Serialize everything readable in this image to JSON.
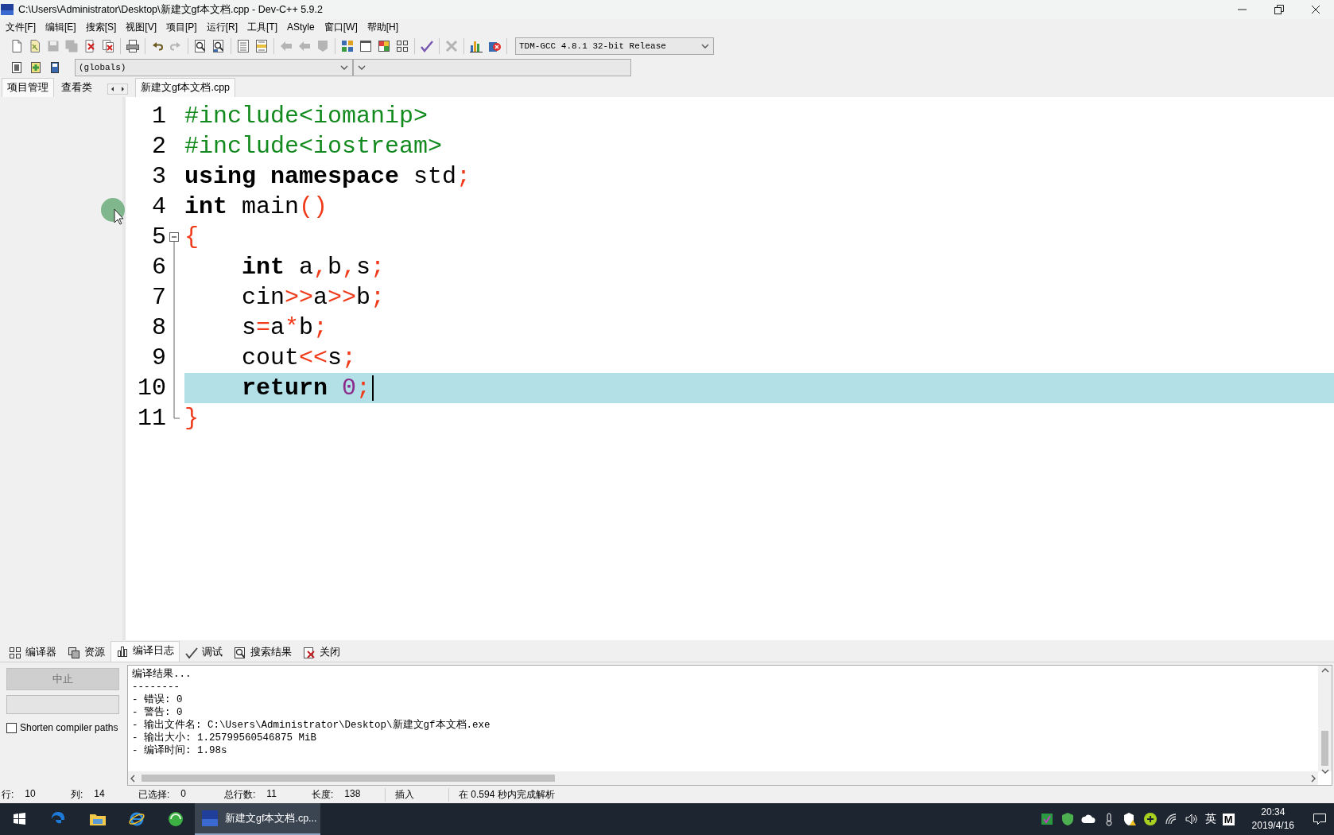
{
  "window": {
    "title": "C:\\Users\\Administrator\\Desktop\\新建文gf本文档.cpp - Dev-C++ 5.9.2"
  },
  "menu": [
    "文件[F]",
    "编辑[E]",
    "搜索[S]",
    "视图[V]",
    "项目[P]",
    "运行[R]",
    "工具[T]",
    "AStyle",
    "窗口[W]",
    "帮助[H]"
  ],
  "toolbar": [
    {
      "buttons": [
        {
          "kind": "new",
          "disabled": false
        },
        {
          "kind": "open",
          "disabled": false
        },
        {
          "kind": "save",
          "disabled": true
        },
        {
          "kind": "saveall",
          "disabled": true
        },
        {
          "kind": "close",
          "disabled": false
        },
        {
          "kind": "closeall",
          "disabled": false
        }
      ]
    },
    {
      "buttons": [
        {
          "kind": "print",
          "disabled": false
        }
      ]
    },
    {
      "buttons": [
        {
          "kind": "undo",
          "disabled": false
        },
        {
          "kind": "redo",
          "disabled": true
        }
      ]
    },
    {
      "buttons": [
        {
          "kind": "find",
          "disabled": false
        },
        {
          "kind": "replace",
          "disabled": false
        }
      ]
    },
    {
      "buttons": [
        {
          "kind": "indent",
          "disabled": false
        },
        {
          "kind": "unindent",
          "disabled": false
        }
      ]
    },
    {
      "buttons": [
        {
          "kind": "prev",
          "disabled": true
        },
        {
          "kind": "next",
          "disabled": true
        },
        {
          "kind": "bookmark",
          "disabled": true
        }
      ]
    },
    {
      "buttons": [
        {
          "kind": "grid",
          "disabled": false
        },
        {
          "kind": "window",
          "disabled": false
        },
        {
          "kind": "colors",
          "disabled": false
        },
        {
          "kind": "tiles",
          "disabled": false
        }
      ]
    },
    {
      "buttons": [
        {
          "kind": "check",
          "disabled": false
        }
      ]
    },
    {
      "buttons": [
        {
          "kind": "cross",
          "disabled": true
        }
      ]
    },
    {
      "buttons": [
        {
          "kind": "chart",
          "disabled": false
        },
        {
          "kind": "stop",
          "disabled": false
        }
      ]
    }
  ],
  "compiler": {
    "value": "TDM-GCC 4.8.1 32-bit Release"
  },
  "scope": {
    "value": "(globals)"
  },
  "side_tabs": [
    {
      "label": "项目管理",
      "selected": true
    },
    {
      "label": "查看类",
      "selected": false
    }
  ],
  "editor_tabs": [
    {
      "label": "新建文gf本文档.cpp",
      "selected": true
    }
  ],
  "code": [
    {
      "number": "1",
      "current": false,
      "indented": false,
      "kind": "plain",
      "tokens": [
        {
          "kind": "preprocessor",
          "text": "#include<iomanip>"
        }
      ]
    },
    {
      "number": "2",
      "current": false,
      "indented": false,
      "kind": "plain",
      "tokens": [
        {
          "kind": "preprocessor",
          "text": "#include<iostream>"
        }
      ]
    },
    {
      "number": "3",
      "current": false,
      "indented": false,
      "kind": "plain",
      "tokens": [
        {
          "kind": "keyword",
          "text": "using namespace"
        },
        {
          "kind": "plain",
          "text": " std"
        },
        {
          "kind": "symbol",
          "text": ";"
        }
      ]
    },
    {
      "number": "4",
      "current": false,
      "indented": false,
      "kind": "plain",
      "tokens": [
        {
          "kind": "keyword",
          "text": "int"
        },
        {
          "kind": "plain",
          "text": " main"
        },
        {
          "kind": "symbol",
          "text": "()"
        }
      ]
    },
    {
      "number": "5",
      "current": false,
      "indented": false,
      "kind": "foldstart",
      "tokens": [
        {
          "kind": "symbol",
          "text": "{"
        }
      ]
    },
    {
      "number": "6",
      "current": false,
      "indented": true,
      "kind": "folded",
      "tokens": [
        {
          "kind": "keyword",
          "text": "int"
        },
        {
          "kind": "plain",
          "text": " a"
        },
        {
          "kind": "symbol",
          "text": ","
        },
        {
          "kind": "plain",
          "text": "b"
        },
        {
          "kind": "symbol",
          "text": ","
        },
        {
          "kind": "plain",
          "text": "s"
        },
        {
          "kind": "symbol",
          "text": ";"
        }
      ]
    },
    {
      "number": "7",
      "current": false,
      "indented": true,
      "kind": "folded",
      "tokens": [
        {
          "kind": "plain",
          "text": "cin"
        },
        {
          "kind": "symbol",
          "text": ">>"
        },
        {
          "kind": "plain",
          "text": "a"
        },
        {
          "kind": "symbol",
          "text": ">>"
        },
        {
          "kind": "plain",
          "text": "b"
        },
        {
          "kind": "symbol",
          "text": ";"
        }
      ]
    },
    {
      "number": "8",
      "current": false,
      "indented": true,
      "kind": "folded",
      "tokens": [
        {
          "kind": "plain",
          "text": "s"
        },
        {
          "kind": "symbol",
          "text": "="
        },
        {
          "kind": "plain",
          "text": "a"
        },
        {
          "kind": "symbol",
          "text": "*"
        },
        {
          "kind": "plain",
          "text": "b"
        },
        {
          "kind": "symbol",
          "text": ";"
        }
      ]
    },
    {
      "number": "9",
      "current": false,
      "indented": true,
      "kind": "folded",
      "tokens": [
        {
          "kind": "plain",
          "text": "cout"
        },
        {
          "kind": "symbol",
          "text": "<<"
        },
        {
          "kind": "plain",
          "text": "s"
        },
        {
          "kind": "symbol",
          "text": ";"
        }
      ]
    },
    {
      "number": "10",
      "current": true,
      "indented": true,
      "kind": "folded",
      "tokens": [
        {
          "kind": "keyword",
          "text": "return"
        },
        {
          "kind": "number",
          "text": " 0"
        },
        {
          "kind": "symbol",
          "text": ";"
        }
      ]
    },
    {
      "number": "11",
      "current": false,
      "indented": false,
      "kind": "foldend",
      "tokens": [
        {
          "kind": "symbol",
          "text": "}"
        }
      ]
    }
  ],
  "bottom_tabs": [
    {
      "kind": "compiler",
      "label": "编译器",
      "selected": false
    },
    {
      "kind": "resources",
      "label": "资源",
      "selected": false
    },
    {
      "kind": "log",
      "label": "编译日志",
      "selected": true
    },
    {
      "kind": "debug",
      "label": "调试",
      "selected": false
    },
    {
      "kind": "search",
      "label": "搜索结果",
      "selected": false
    },
    {
      "kind": "close",
      "label": "关闭",
      "selected": false
    }
  ],
  "abort_button": {
    "label": "中止",
    "disabled": true
  },
  "progress": {
    "level": 0
  },
  "shorten_paths": {
    "label": "Shorten compiler paths",
    "checked": false
  },
  "log": [
    "编译结果...",
    "--------",
    "- 错误: 0",
    "- 警告: 0",
    "- 输出文件名: C:\\Users\\Administrator\\Desktop\\新建文gf本文档.exe",
    "- 输出大小: 1.25799560546875 MiB",
    "- 编译时间: 1.98s"
  ],
  "status": {
    "fields": [
      {
        "label": "行:",
        "value": "10"
      },
      {
        "label": "列:",
        "value": "14"
      },
      {
        "label": "已选择:",
        "value": "0"
      },
      {
        "label": "总行数:",
        "value": "11"
      },
      {
        "label": "长度:",
        "value": "138"
      }
    ],
    "messages": [
      "插入",
      "在 0.594 秒内完成解析"
    ]
  },
  "taskbar": {
    "tasks": [
      {
        "label": "新建文gf本文档.cp...",
        "active": true
      }
    ],
    "ime": "英",
    "ime_mode": "M",
    "time": "20:34",
    "date": "2019/4/16"
  }
}
